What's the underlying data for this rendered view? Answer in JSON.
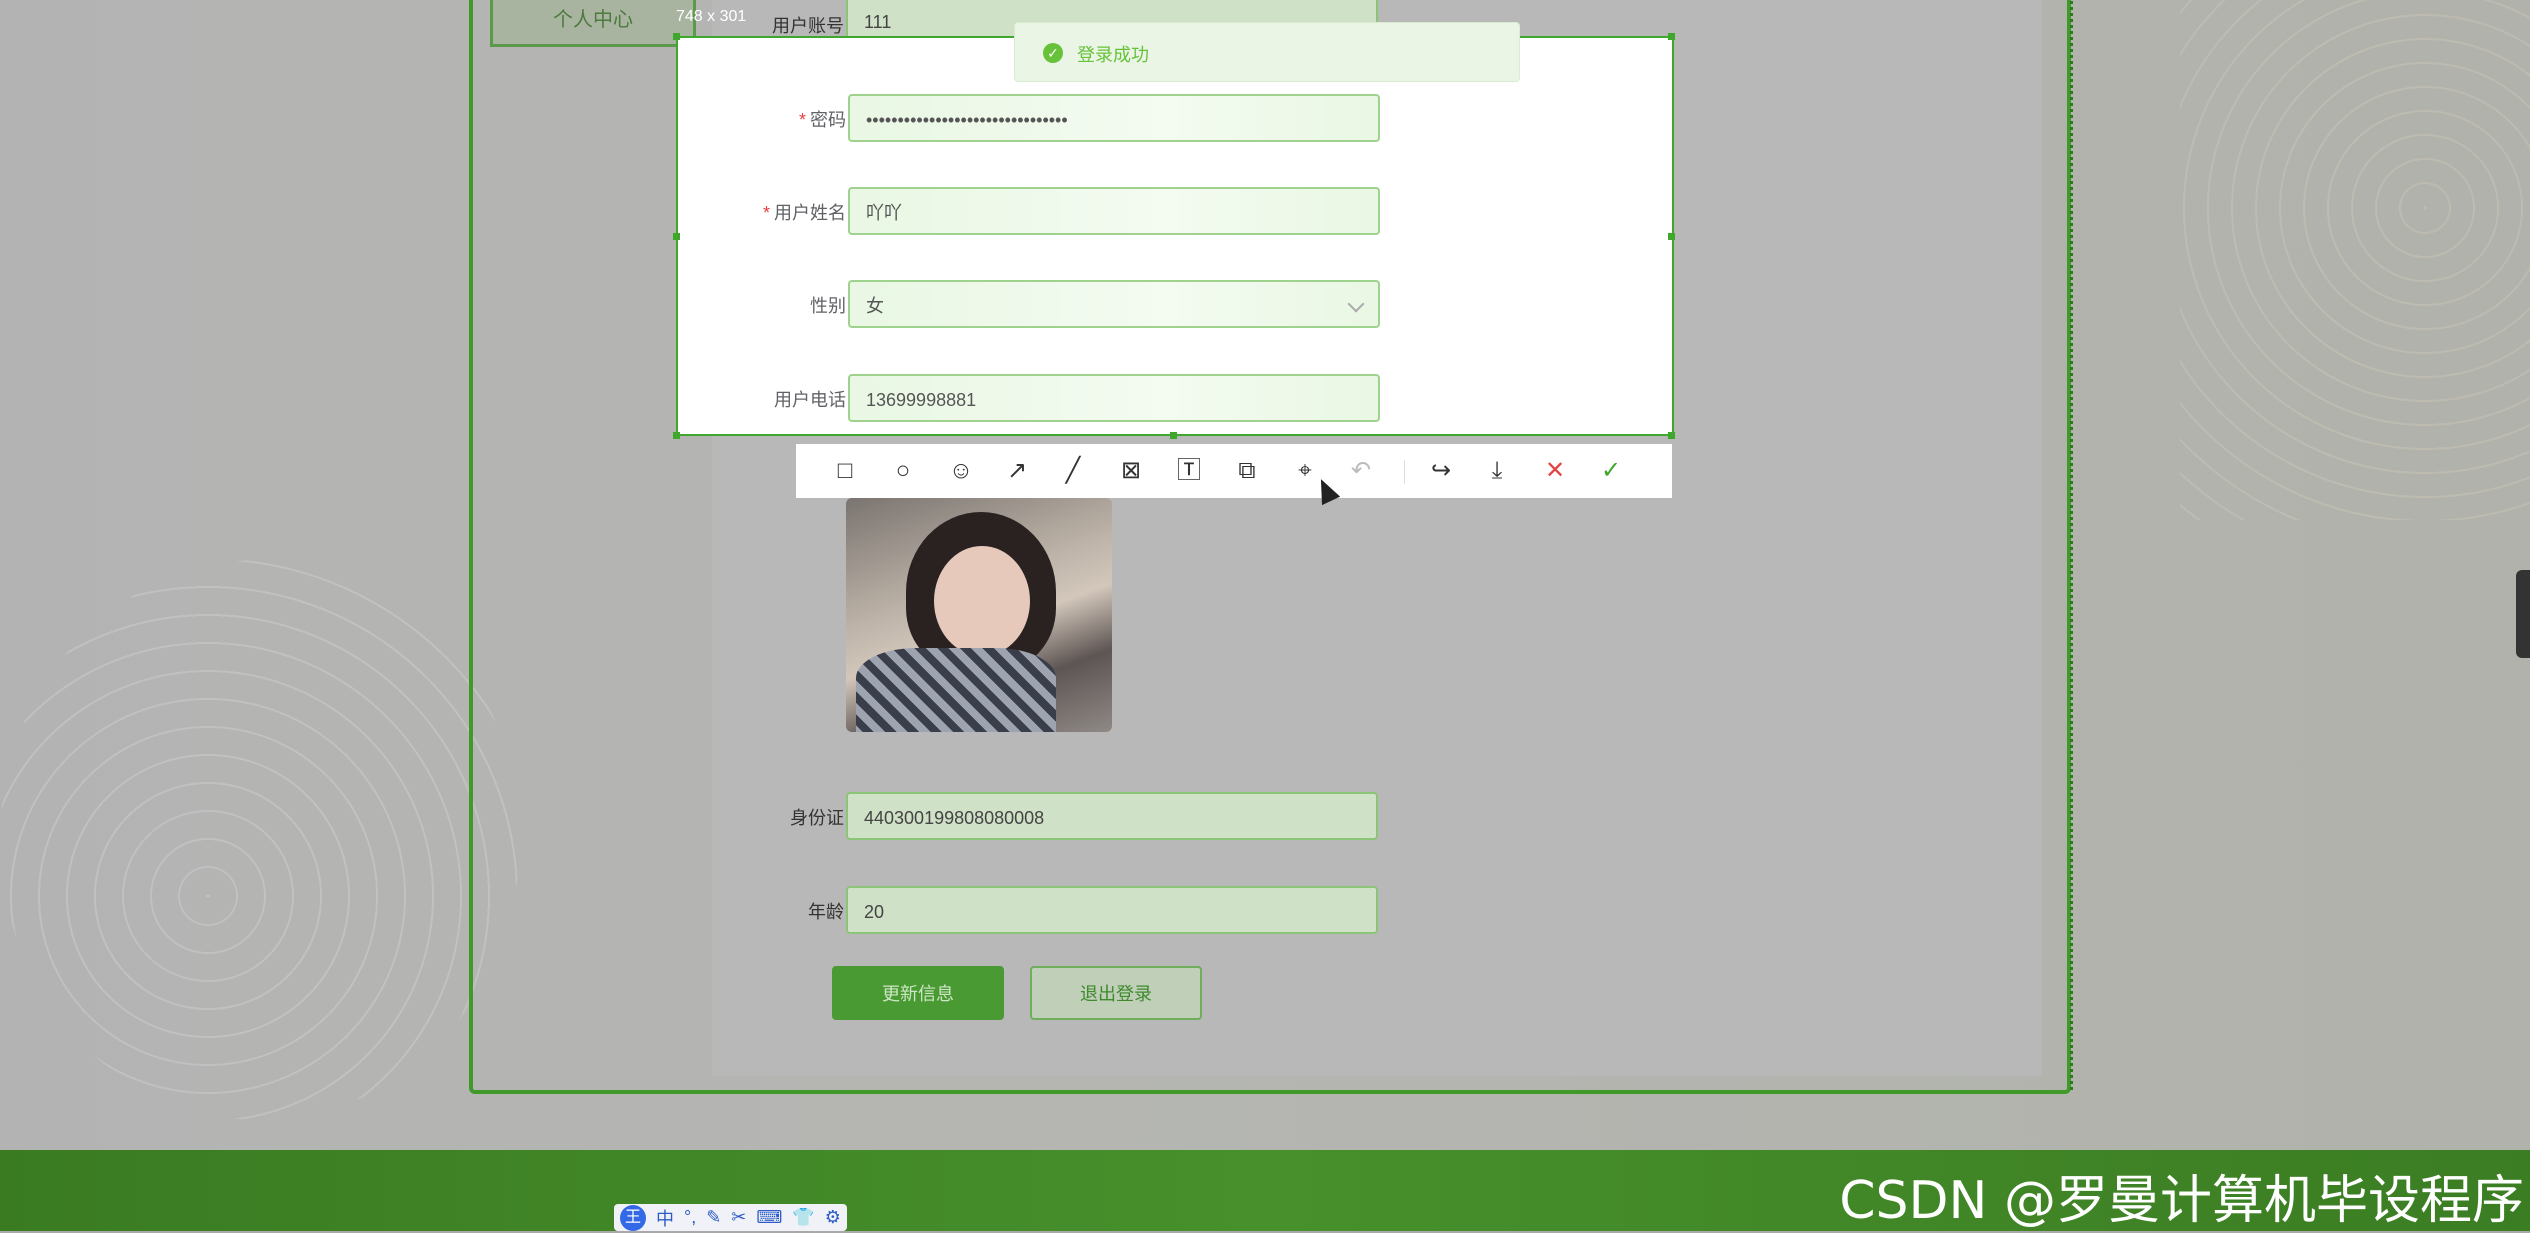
{
  "nav": {
    "personal_center": "个人中心"
  },
  "capture": {
    "size_label": "748 x 301"
  },
  "toast": {
    "message": "登录成功"
  },
  "form": {
    "account": {
      "label": "用户账号",
      "value": "111"
    },
    "password": {
      "label": "密码",
      "value": "••••••••••••••••••••••••••••••••"
    },
    "name": {
      "label": "用户姓名",
      "value": "吖吖"
    },
    "gender": {
      "label": "性别",
      "value": "女"
    },
    "phone": {
      "label": "用户电话",
      "value": "13699998881"
    },
    "id_card": {
      "label": "身份证",
      "value": "440300199808080008"
    },
    "age": {
      "label": "年龄",
      "value": "20"
    },
    "required_mark": "*"
  },
  "buttons": {
    "update": "更新信息",
    "logout": "退出登录"
  },
  "toolbar": {
    "icons": [
      "rectangle-icon",
      "ellipse-icon",
      "emoji-icon",
      "arrow-icon",
      "line-icon",
      "mosaic-icon",
      "text-icon",
      "pin-icon",
      "ocr-icon",
      "undo-icon",
      "share-icon",
      "download-icon",
      "close-icon",
      "confirm-icon"
    ]
  },
  "watermark": "CSDN @罗曼计算机毕设程序",
  "ime": {
    "logo": "王",
    "mode": "中"
  },
  "colors": {
    "brand_green": "#3fa72b",
    "toast_green": "#67c23a",
    "required_red": "#e54040"
  }
}
